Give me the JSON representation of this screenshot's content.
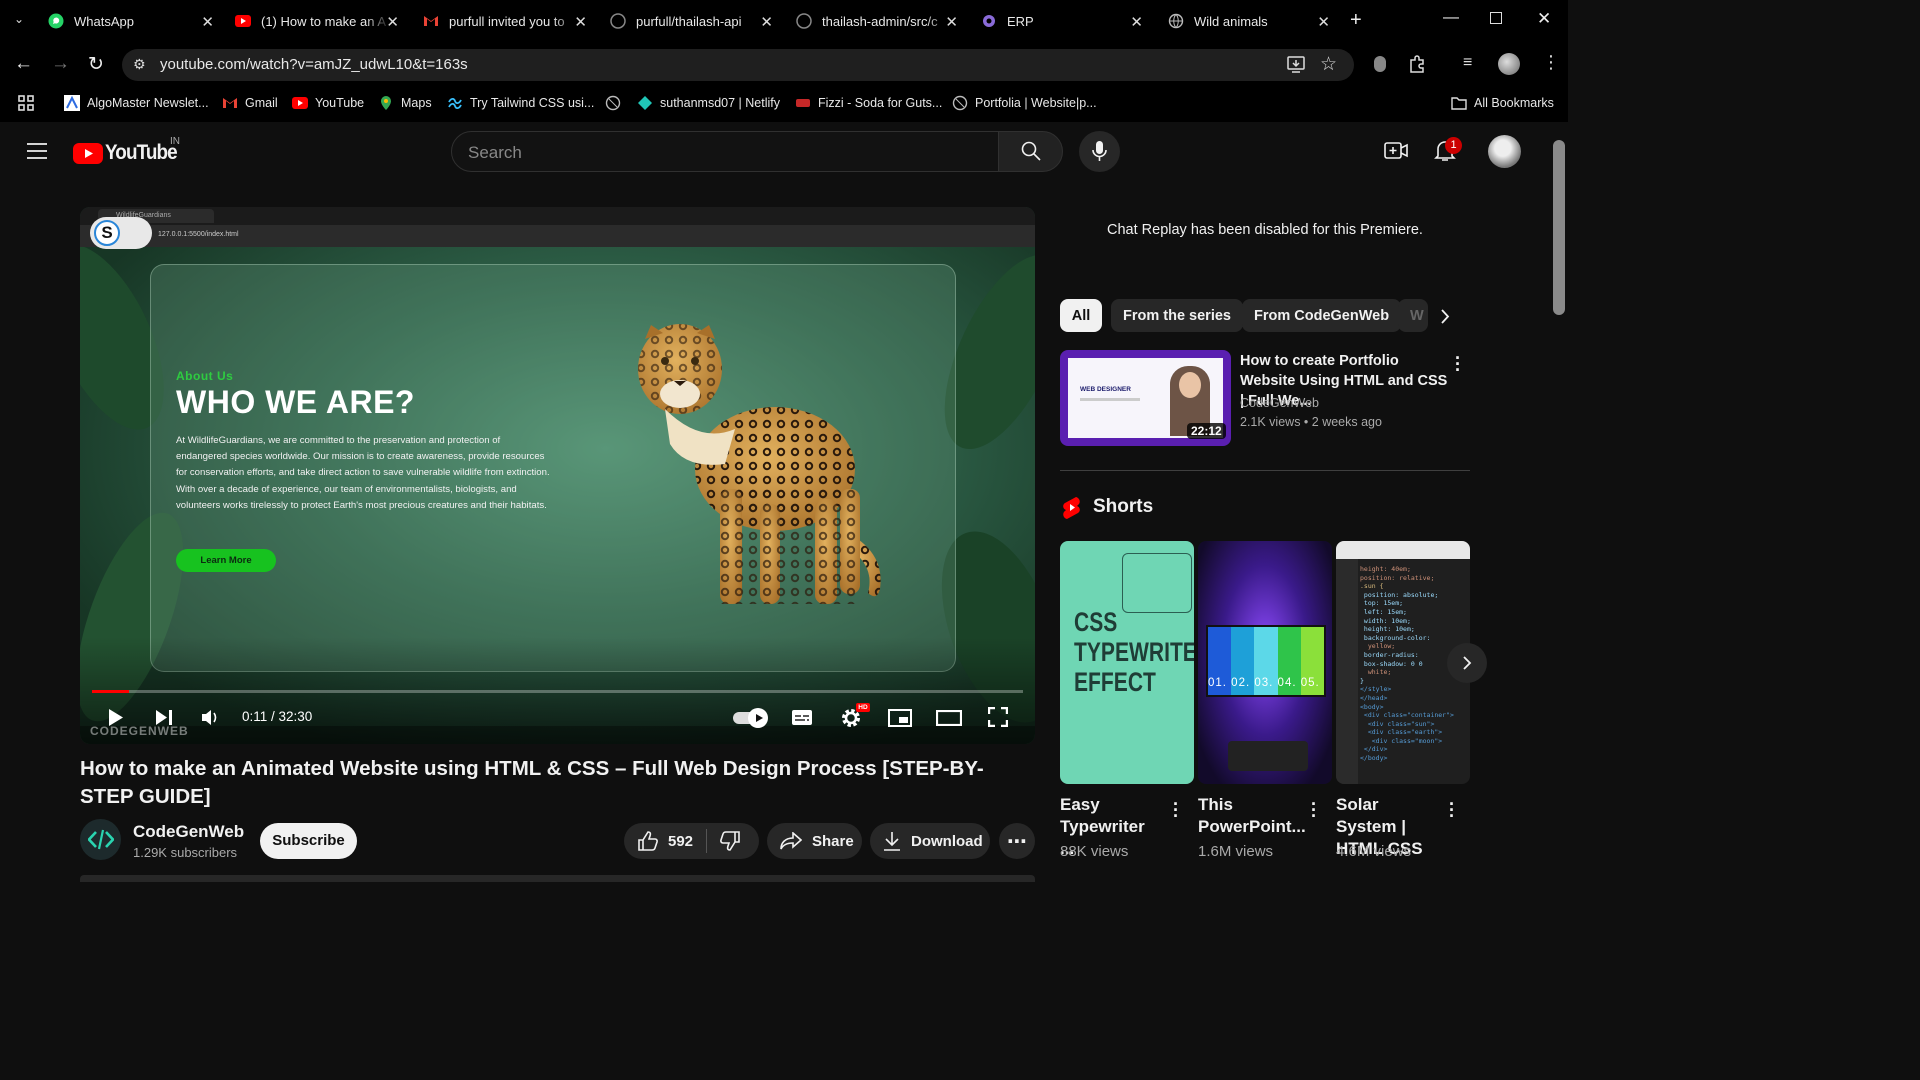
{
  "browser": {
    "tabs": [
      {
        "title": "WhatsApp"
      },
      {
        "title": "(1) How to make an A"
      },
      {
        "title": "purfull invited you to"
      },
      {
        "title": "purfull/thailash-api"
      },
      {
        "title": "thailash-admin/src/c"
      },
      {
        "title": "ERP"
      },
      {
        "title": "Wild animals"
      }
    ],
    "url": "youtube.com/watch?v=amJZ_udwL10&t=163s",
    "bookmarks": [
      {
        "label": "AlgoMaster Newslet..."
      },
      {
        "label": "Gmail"
      },
      {
        "label": "YouTube"
      },
      {
        "label": "Maps"
      },
      {
        "label": "Try Tailwind CSS usi..."
      },
      {
        "label": "suthanmsd07 | Netlify"
      },
      {
        "label": "Fizzi - Soda for Guts..."
      },
      {
        "label": "Portfolia | Website|p..."
      }
    ],
    "all_bookmarks": "All Bookmarks"
  },
  "youtube": {
    "logo": "YouTube",
    "country": "IN",
    "search_placeholder": "Search",
    "notification_count": "1"
  },
  "video": {
    "inner_tab": "WildlifeGuardians",
    "inner_url": "127.0.0.1:5500/index.html",
    "about_label": "About Us",
    "heading": "WHO WE ARE?",
    "body": "At WildlifeGuardians, we are committed to the preservation and protection of endangered species worldwide. Our mission is to create awareness, provide resources for conservation efforts, and take direct action to save vulnerable wildlife from extinction. With over a decade of experience, our team of environmentalists, biologists, and volunteers works tirelessly to protect Earth's most precious creatures and their habitats.",
    "learn_more": "Learn More",
    "watermark": "CODEGENWEB",
    "time": "0:11 / 32:30",
    "progress": 0.006,
    "hd_badge": "HD",
    "title": "How to make an Animated Website using HTML & CSS – Full Web Design Process [STEP-BY-STEP GUIDE]",
    "channel": "CodeGenWeb",
    "subscribers": "1.29K subscribers",
    "subscribe": "Subscribe",
    "likes": "592",
    "share": "Share",
    "download": "Download"
  },
  "sidebar": {
    "chat_notice": "Chat Replay has been disabled for this Premiere.",
    "chips": [
      "All",
      "From the series",
      "From CodeGenWeb",
      "W"
    ],
    "recommended": {
      "title": "How to create Portfolio Website Using HTML and CSS | Full We...",
      "channel": "CodeGenWeb",
      "meta": "2.1K views • 2 weeks ago",
      "duration": "22:12",
      "thumb_label": "WEB DESIGNER"
    },
    "shorts_heading": "Shorts",
    "shorts": [
      {
        "title": "Easy Typewriter ...",
        "views": "88K views",
        "thumb_text": "CSS TYPEWRITER EFFECT"
      },
      {
        "title": "This PowerPoint...",
        "views": "1.6M views",
        "thumb_text": "01. 02. 03. 04. 05."
      },
      {
        "title": "Solar System | HTML CSS",
        "views": "4.6M views",
        "thumb_text": "code"
      }
    ]
  }
}
